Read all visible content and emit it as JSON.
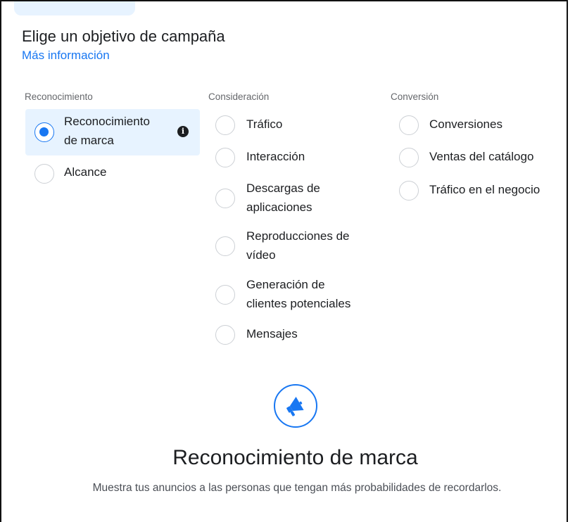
{
  "header": {
    "title": "Elige un objetivo de campaña",
    "learn_more": "Más información"
  },
  "groups": {
    "awareness": {
      "label": "Reconocimiento",
      "options": [
        {
          "line1": "Reconocimiento",
          "line2": "de marca",
          "selected": true
        },
        {
          "line1": "Alcance",
          "line2": "",
          "selected": false
        }
      ]
    },
    "consideration": {
      "label": "Consideración",
      "options": [
        {
          "line1": "Tráfico",
          "line2": ""
        },
        {
          "line1": "Interacción",
          "line2": ""
        },
        {
          "line1": "Descargas de",
          "line2": "aplicaciones"
        },
        {
          "line1": "Reproducciones de",
          "line2": "vídeo"
        },
        {
          "line1": "Generación de",
          "line2": "clientes potenciales"
        },
        {
          "line1": "Mensajes",
          "line2": ""
        }
      ]
    },
    "conversion": {
      "label": "Conversión",
      "options": [
        {
          "line1": "Conversiones",
          "line2": ""
        },
        {
          "line1": "Ventas del catálogo",
          "line2": ""
        },
        {
          "line1": "Tráfico en el negocio",
          "line2": ""
        }
      ]
    }
  },
  "detail": {
    "icon": "megaphone-icon",
    "title": "Reconocimiento de marca",
    "description": "Muestra tus anuncios a las personas que tengan más probabilidades de recordarlos."
  },
  "colors": {
    "accent": "#1877f2",
    "selected_bg": "#e7f3ff"
  }
}
